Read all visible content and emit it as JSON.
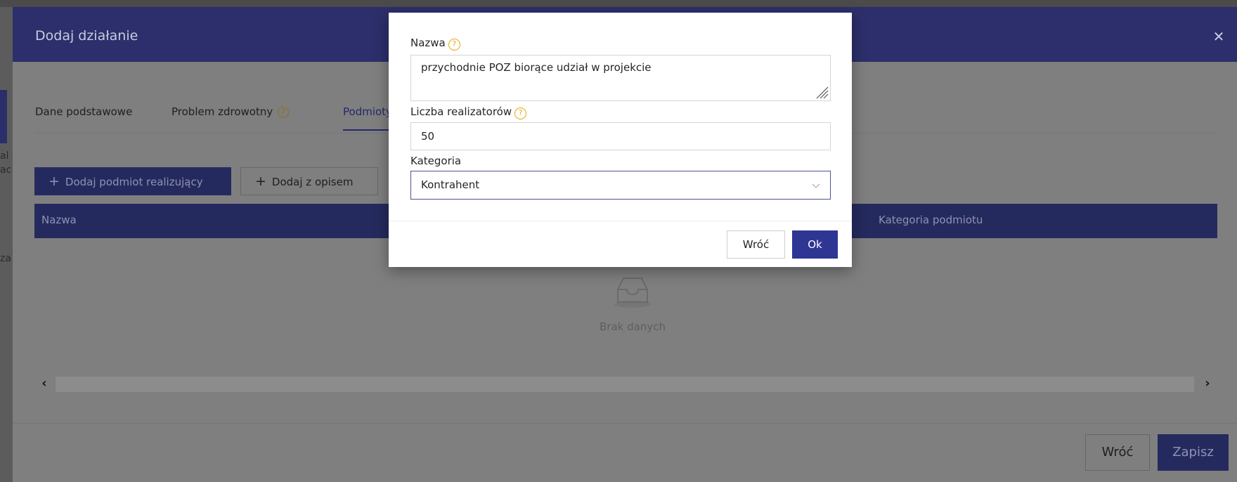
{
  "background": {
    "fragments": [
      "al",
      "ac",
      "za"
    ]
  },
  "outer_modal": {
    "title": "Dodaj działanie",
    "close_icon": "close-icon",
    "tabs": [
      {
        "label": "Dane podstawowe",
        "help": false
      },
      {
        "label": "Problem zdrowotny",
        "help": true
      },
      {
        "label": "Podmioty",
        "help": false,
        "active": true
      }
    ],
    "help_glyph": "?",
    "toolbar": {
      "add_entity_label": "Dodaj podmiot realizujący",
      "add_with_desc_label": "Dodaj z opisem",
      "plus_glyph": "+"
    },
    "table": {
      "columns": [
        "Nazwa",
        "Kategoria podmiotu"
      ],
      "empty_text": "Brak danych"
    },
    "scrollbar": {
      "left_glyph": "‹",
      "right_glyph": "›"
    },
    "footer": {
      "back_label": "Wróć",
      "save_label": "Zapisz"
    }
  },
  "dialog": {
    "name_label": "Nazwa",
    "name_value": "przychodnie POZ biorące udział w projekcie",
    "count_label": "Liczba realizatorów",
    "count_value": "50",
    "category_label": "Kategoria",
    "category_value": "Kontrahent",
    "back_label": "Wróć",
    "ok_label": "Ok"
  },
  "colors": {
    "header": "#2c2f6b",
    "primary": "#2e3593",
    "help": "#e5a817"
  }
}
